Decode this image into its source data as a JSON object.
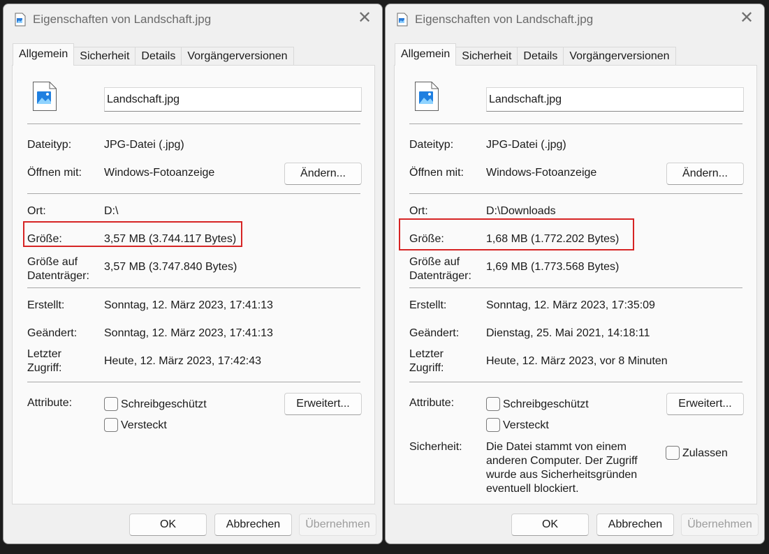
{
  "dialogs": [
    {
      "title": "Eigenschaften von Landschaft.jpg",
      "tabs": [
        "Allgemein",
        "Sicherheit",
        "Details",
        "Vorgängerversionen"
      ],
      "filename": "Landschaft.jpg",
      "dateityp_label": "Dateityp:",
      "dateityp_value": "JPG-Datei (.jpg)",
      "oeffnen_label": "Öffnen mit:",
      "oeffnen_value": "Windows-Fotoanzeige",
      "aendern_label": "Ändern...",
      "ort_label": "Ort:",
      "ort_value": "D:\\",
      "groesse_label": "Größe:",
      "groesse_value": "3,57 MB (3.744.117 Bytes)",
      "groesse_disk_label_1": "Größe auf",
      "groesse_disk_label_2": "Datenträger:",
      "groesse_disk_value": "3,57 MB (3.747.840 Bytes)",
      "erstellt_label": "Erstellt:",
      "erstellt_value": "Sonntag, 12. März 2023, 17:41:13",
      "geaendert_label": "Geändert:",
      "geaendert_value": "Sonntag, 12. März 2023, 17:41:13",
      "zugriff_label_1": "Letzter",
      "zugriff_label_2": "Zugriff:",
      "zugriff_value": "Heute, 12. März 2023, 17:42:43",
      "attribute_label": "Attribute:",
      "schreibgeschuetzt": "Schreibgeschützt",
      "versteckt": "Versteckt",
      "erweitert_label": "Erweitert...",
      "ok_label": "OK",
      "abbrechen_label": "Abbrechen",
      "uebernehmen_label": "Übernehmen"
    },
    {
      "title": "Eigenschaften von Landschaft.jpg",
      "tabs": [
        "Allgemein",
        "Sicherheit",
        "Details",
        "Vorgängerversionen"
      ],
      "filename": "Landschaft.jpg",
      "dateityp_label": "Dateityp:",
      "dateityp_value": "JPG-Datei (.jpg)",
      "oeffnen_label": "Öffnen mit:",
      "oeffnen_value": "Windows-Fotoanzeige",
      "aendern_label": "Ändern...",
      "ort_label": "Ort:",
      "ort_value": "D:\\Downloads",
      "groesse_label": "Größe:",
      "groesse_value": "1,68 MB (1.772.202 Bytes)",
      "groesse_disk_label_1": "Größe auf",
      "groesse_disk_label_2": "Datenträger:",
      "groesse_disk_value": "1,69 MB (1.773.568 Bytes)",
      "erstellt_label": "Erstellt:",
      "erstellt_value": "Sonntag, 12. März 2023, 17:35:09",
      "geaendert_label": "Geändert:",
      "geaendert_value": "Dienstag, 25. Mai 2021, 14:18:11",
      "zugriff_label_1": "Letzter",
      "zugriff_label_2": "Zugriff:",
      "zugriff_value": "Heute, 12. März 2023, vor 8 Minuten",
      "attribute_label": "Attribute:",
      "schreibgeschuetzt": "Schreibgeschützt",
      "versteckt": "Versteckt",
      "erweitert_label": "Erweitert...",
      "sicherheit_label": "Sicherheit:",
      "sicherheit_text": "Die Datei stammt von einem anderen Computer. Der Zugriff wurde aus Sicherheitsgründen eventuell blockiert.",
      "zulassen_label": "Zulassen",
      "ok_label": "OK",
      "abbrechen_label": "Abbrechen",
      "uebernehmen_label": "Übernehmen"
    }
  ],
  "highlight_color": "#d62424",
  "icons": {
    "title": "image-file-icon",
    "file": "jpg-file-icon",
    "close": "close-icon"
  }
}
